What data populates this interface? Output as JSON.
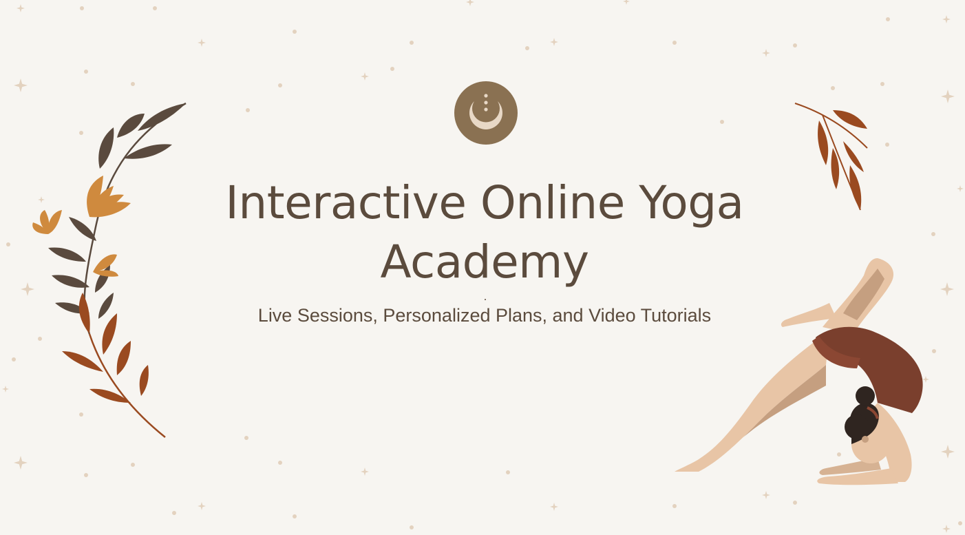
{
  "slide": {
    "title": "Interactive Online Yoga Academy",
    "subtitle": "Live Sessions, Personalized Plans, and Video Tutorials"
  },
  "icons": {
    "logo": "moon-logo-icon",
    "left_decoration": "floral-branch-icon",
    "right_decoration": "leaf-branch-icon",
    "illustration": "yoga-pose-illustration"
  },
  "colors": {
    "background": "#f7f5f1",
    "text": "#5b4b3d",
    "logo_bg": "#8a7152",
    "logo_moon": "#e8d8c6",
    "leaf_dark": "#5a4a3e",
    "leaf_rust": "#9a4a20",
    "flower_orange": "#cf8a3e",
    "skin": "#e8c5a6",
    "skin_shadow": "#c59f80",
    "bodysuit": "#7a3f2d",
    "hair": "#2f2520",
    "sparkle": "#e3d2bf"
  }
}
